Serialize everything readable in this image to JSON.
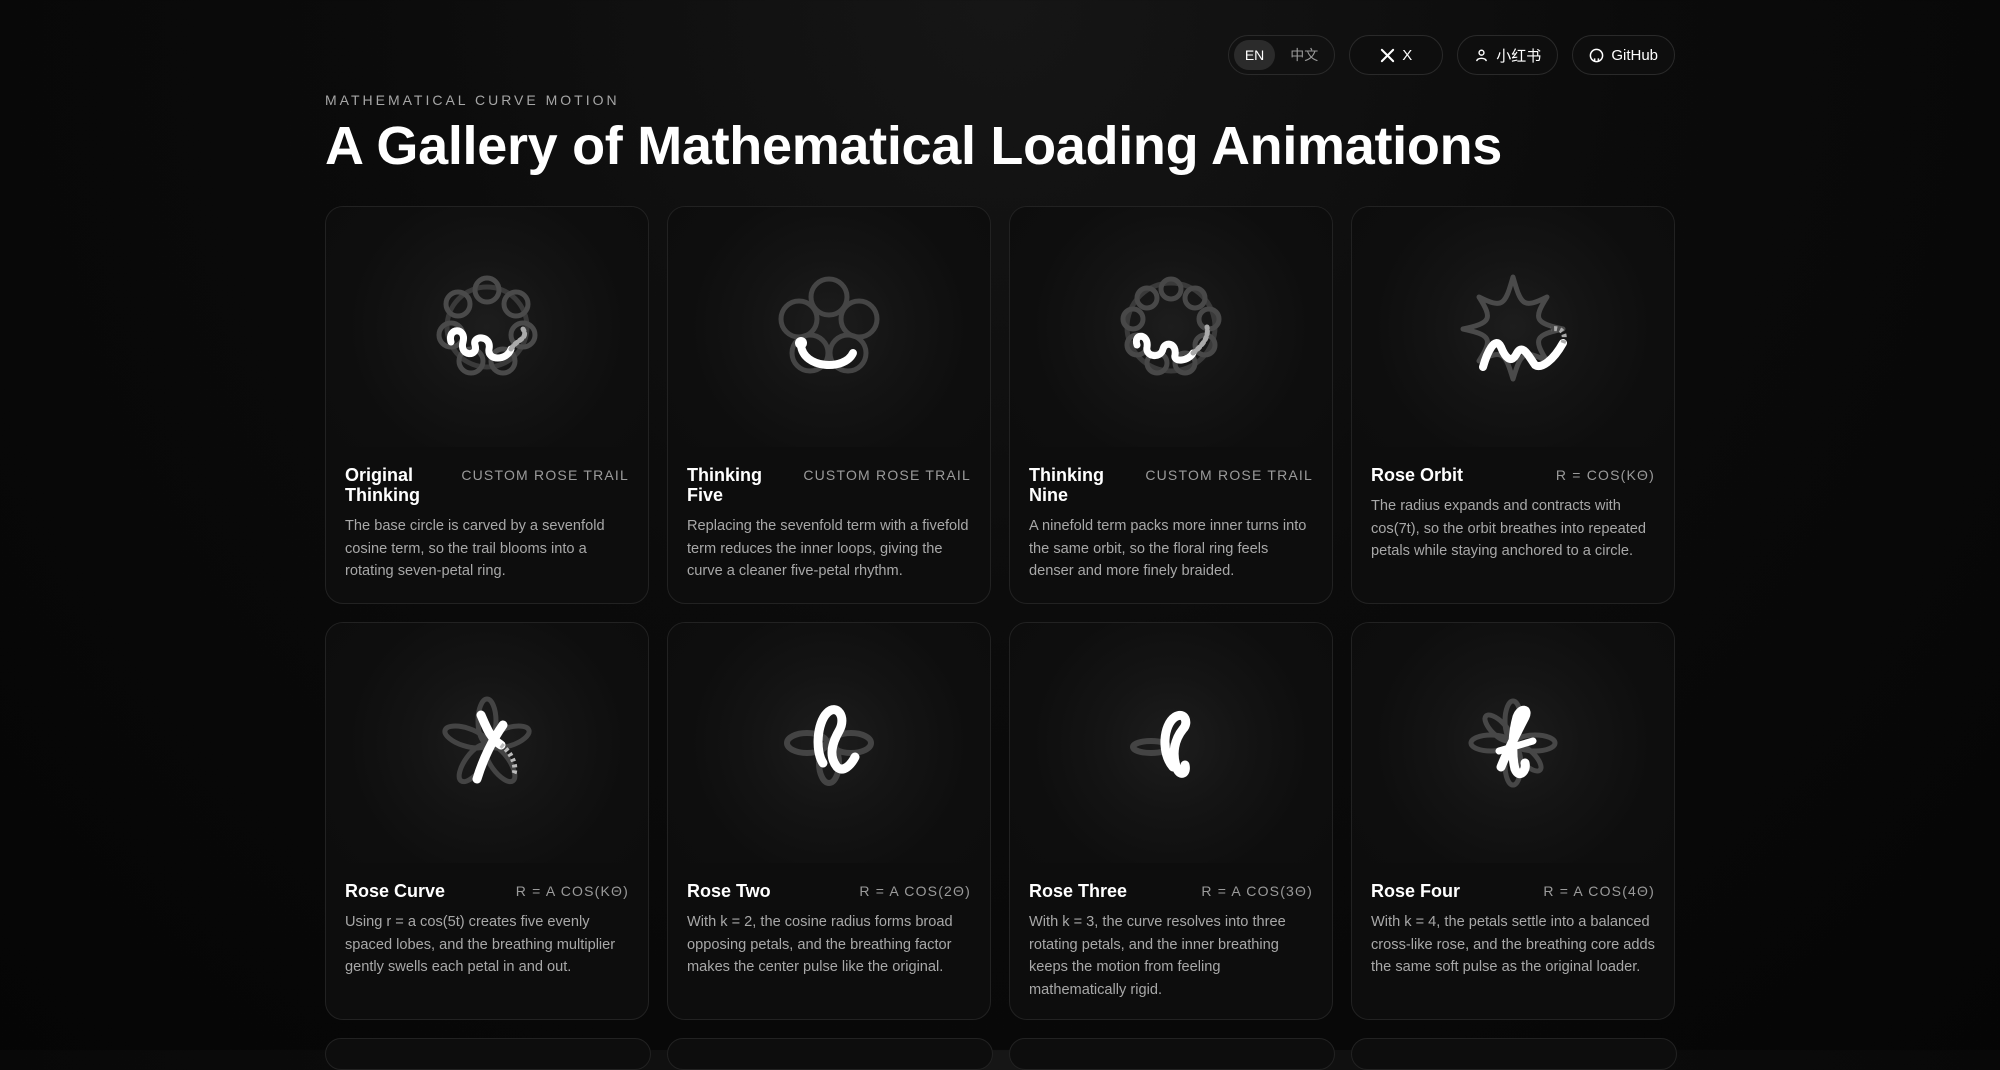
{
  "lang": {
    "en": "EN",
    "zh": "中文"
  },
  "links": {
    "x": "X",
    "xhs": "小红书",
    "github": "GitHub"
  },
  "eyebrow": "MATHEMATICAL CURVE MOTION",
  "title": "A Gallery of Mathematical Loading Animations",
  "cards": [
    {
      "title": "Original Thinking",
      "tag": "CUSTOM ROSE TRAIL",
      "desc": "The base circle is carved by a sevenfold cosine term, so the trail blooms into a rotating seven-petal ring."
    },
    {
      "title": "Thinking Five",
      "tag": "CUSTOM ROSE TRAIL",
      "desc": "Replacing the sevenfold term with a fivefold term reduces the inner loops, giving the curve a cleaner five-petal rhythm."
    },
    {
      "title": "Thinking Nine",
      "tag": "CUSTOM ROSE TRAIL",
      "desc": "A ninefold term packs more inner turns into the same orbit, so the floral ring feels denser and more finely braided."
    },
    {
      "title": "Rose Orbit",
      "tag": "R = COS(KΘ)",
      "desc": "The radius expands and contracts with cos(7t), so the orbit breathes into repeated petals while staying anchored to a circle."
    },
    {
      "title": "Rose Curve",
      "tag": "R = A COS(KΘ)",
      "desc": "Using r = a cos(5t) creates five evenly spaced lobes, and the breathing multiplier gently swells each petal in and out."
    },
    {
      "title": "Rose Two",
      "tag": "R = A COS(2Θ)",
      "desc": "With k = 2, the cosine radius forms broad opposing petals, and the breathing factor makes the center pulse like the original."
    },
    {
      "title": "Rose Three",
      "tag": "R = A COS(3Θ)",
      "desc": "With k = 3, the curve resolves into three rotating petals, and the inner breathing keeps the motion from feeling mathematically rigid."
    },
    {
      "title": "Rose Four",
      "tag": "R = A COS(4Θ)",
      "desc": "With k = 4, the petals settle into a balanced cross-like rose, and the breathing core adds the same soft pulse as the original loader."
    }
  ]
}
